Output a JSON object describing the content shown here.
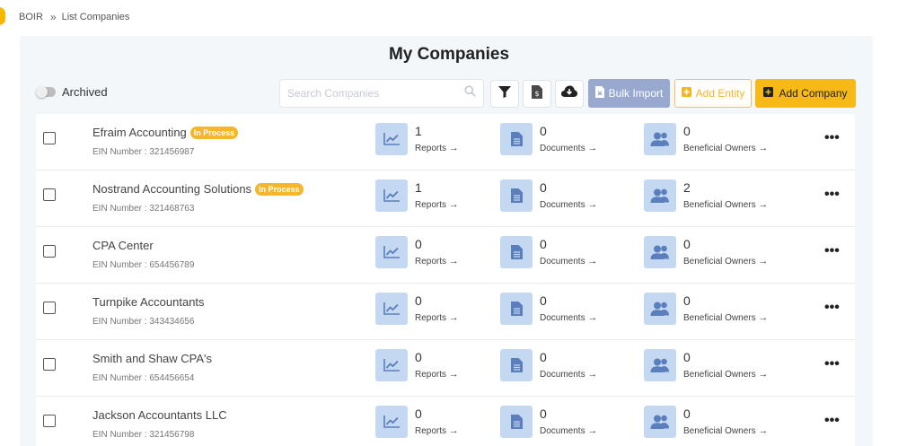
{
  "breadcrumb": {
    "root": "BOIR",
    "current": "List Companies"
  },
  "page_title": "My Companies",
  "filters": {
    "archived_label": "Archived"
  },
  "search": {
    "placeholder": "Search Companies"
  },
  "buttons": {
    "bulk_import": "Bulk Import",
    "add_entity": "Add Entity",
    "add_company": "Add Company"
  },
  "stat_labels": {
    "reports": "Reports",
    "documents": "Documents",
    "owners": "Beneficial Owners"
  },
  "colors": {
    "accent_yellow": "#f7b916",
    "bulk_blue": "#98a8cf",
    "icon_tile": "#c5d8f2",
    "icon_fg": "#5b7fbd"
  },
  "companies": [
    {
      "name": "Efraim Accounting",
      "badge": "In Process",
      "ein": "EIN Number : 321456987",
      "reports": "1",
      "documents": "0",
      "owners": "0"
    },
    {
      "name": "Nostrand Accounting Solutions",
      "badge": "In Process",
      "ein": "EIN Number : 321468763",
      "reports": "1",
      "documents": "0",
      "owners": "2"
    },
    {
      "name": "CPA Center",
      "badge": "",
      "ein": "EIN Number : 654456789",
      "reports": "0",
      "documents": "0",
      "owners": "0"
    },
    {
      "name": "Turnpike Accountants",
      "badge": "",
      "ein": "EIN Number : 343434656",
      "reports": "0",
      "documents": "0",
      "owners": "0"
    },
    {
      "name": "Smith and Shaw CPA's",
      "badge": "",
      "ein": "EIN Number : 654456654",
      "reports": "0",
      "documents": "0",
      "owners": "0"
    },
    {
      "name": "Jackson Accountants LLC",
      "badge": "",
      "ein": "EIN Number : 321456798",
      "reports": "0",
      "documents": "0",
      "owners": "0"
    }
  ]
}
